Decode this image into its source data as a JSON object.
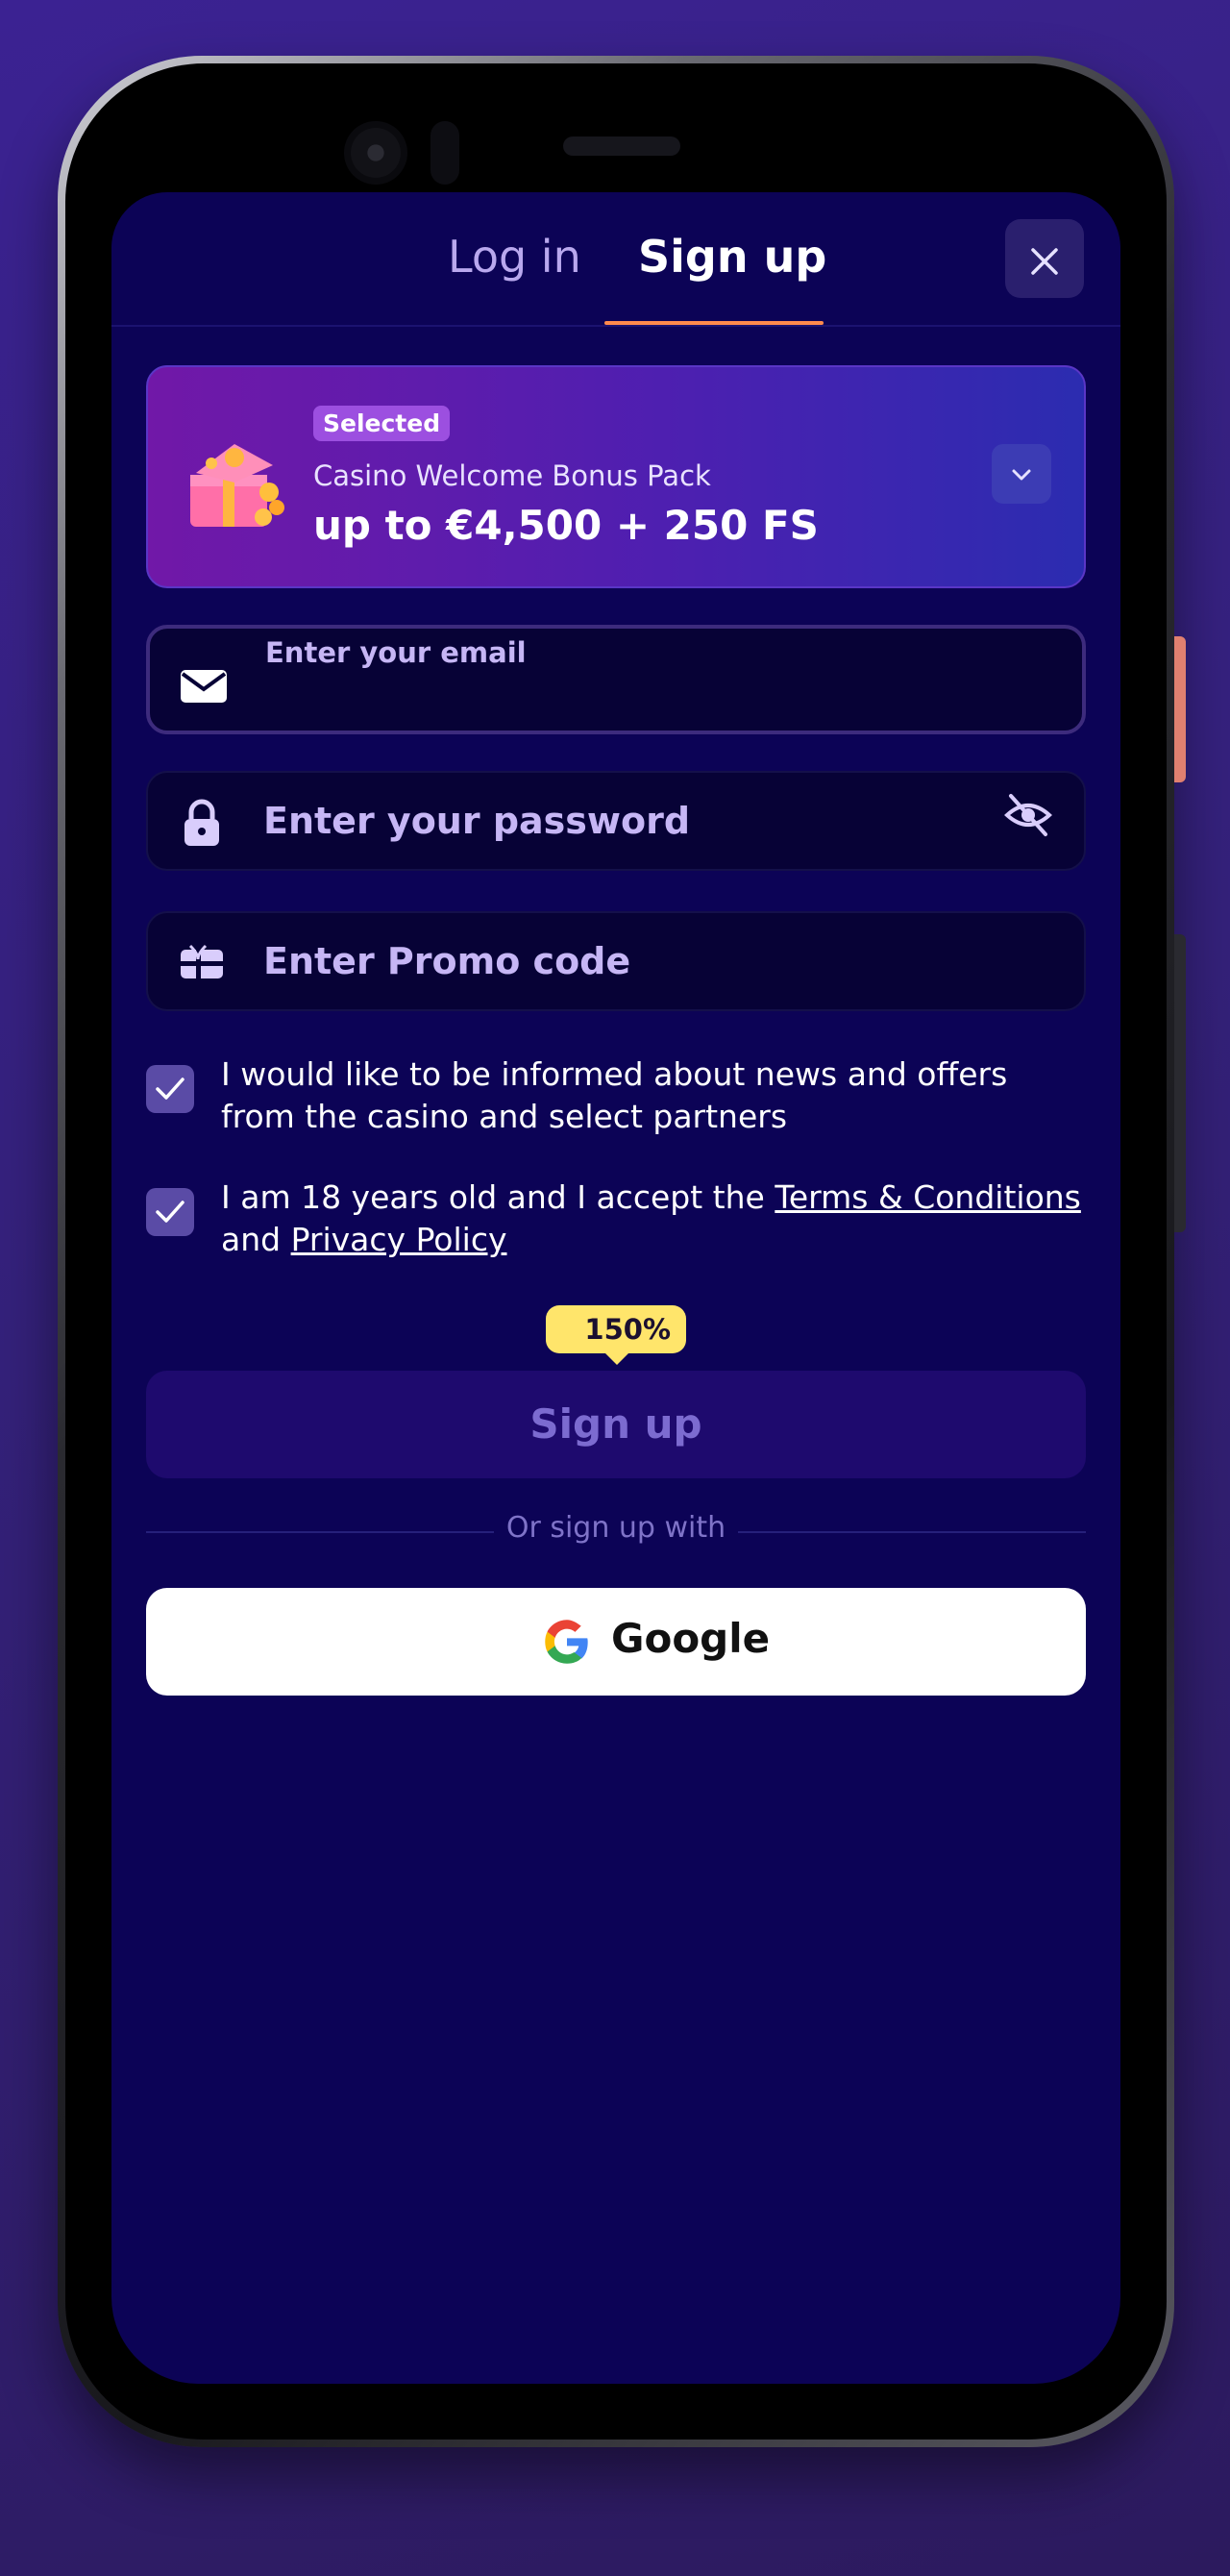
{
  "tabs": {
    "login": "Log in",
    "signup": "Sign up"
  },
  "bonus": {
    "badge": "Selected",
    "name": "Casino Welcome Bonus Pack",
    "amount": "up to €4,500 + 250 FS",
    "icon": "gift-icon"
  },
  "form": {
    "email_label": "Enter your email",
    "email_value": "",
    "password_placeholder": "Enter your password",
    "promo_placeholder": "Enter Promo code",
    "consent_news": "I would like to be informed about news and offers from the casino and select partners",
    "consent_age_prefix": "I am 18 years old and I accept the",
    "terms_link": "Terms & Conditions",
    "consent_and": "and",
    "privacy_link": "Privacy Policy",
    "consent_news_checked": true,
    "consent_age_checked": true
  },
  "signup": {
    "badge": "150%",
    "button": "Sign up"
  },
  "alt": {
    "or_text": "Or sign up with",
    "google": "Google"
  },
  "colors": {
    "screen_bg": "#0c0356",
    "accent_underline": "#ff8a4c",
    "badge_yellow": "#ffe56b",
    "checkbox": "#5a4ba6"
  }
}
